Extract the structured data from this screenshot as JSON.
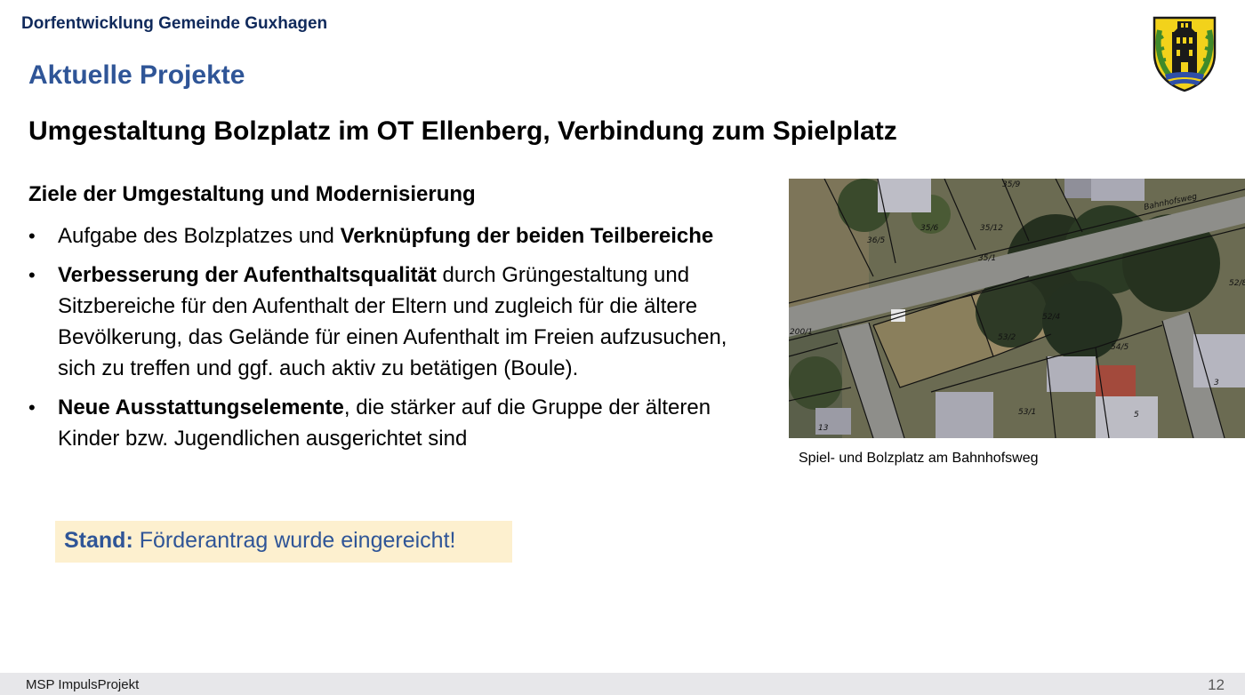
{
  "header": {
    "org_title": "Dorfentwicklung Gemeinde Guxhagen",
    "section_title": "Aktuelle Projekte"
  },
  "project": {
    "title": "Umgestaltung Bolzplatz im OT Ellenberg, Verbindung zum Spielplatz",
    "goals_heading": "Ziele der Umgestaltung und Modernisierung",
    "bullets": [
      {
        "plain_1": "Aufgabe des Bolzplatzes und ",
        "bold_1": "Verknüpfung der beiden Teilbereiche",
        "plain_2": ""
      },
      {
        "plain_1": "",
        "bold_1": "Verbesserung der Aufenthaltsqualität",
        "plain_2": " durch Grüngestaltung und Sitzbereiche  für den Aufenthalt der Eltern und zugleich für die ältere Bevölkerung, das Gelände für einen Aufenthalt im Freien aufzusuchen, sich zu treffen und ggf. auch aktiv zu betätigen (Boule)."
      },
      {
        "plain_1": "",
        "bold_1": "Neue Ausstattungselemente",
        "plain_2": ", die stärker auf die Gruppe der älteren Kinder bzw. Jugendlichen ausgerichtet sind"
      }
    ],
    "bullet_glyph": "•",
    "status_label": "Stand:",
    "status_text": " Förderantrag wurde eingereicht!"
  },
  "image": {
    "caption": "Spiel- und Bolzplatz am Bahnhofsweg",
    "map_labels": {
      "street": "Bahnhofsweg",
      "p1": "35/9",
      "p2": "35/12",
      "p3": "35/6",
      "p4": "36/5",
      "p5": "35/1",
      "p6": "52/4",
      "p7": "53/2",
      "p8": "54/5",
      "p9": "53/1",
      "p10": "200/1",
      "p11": "52/8",
      "p12": "5",
      "p13": "13",
      "p14": "3"
    }
  },
  "footer": {
    "text": "MSP ImpulsProjekt",
    "page_number": "12"
  },
  "colors": {
    "org_title": "#102a5c",
    "section_title": "#2f5597",
    "status_background": "#fdf0cf",
    "footer_background": "#e7e7ea",
    "crest_gold": "#f2d21b",
    "crest_green": "#3f8a2a",
    "crest_blue": "#2f4fa8"
  },
  "icons": {
    "crest": "municipal-coat-of-arms-icon"
  }
}
